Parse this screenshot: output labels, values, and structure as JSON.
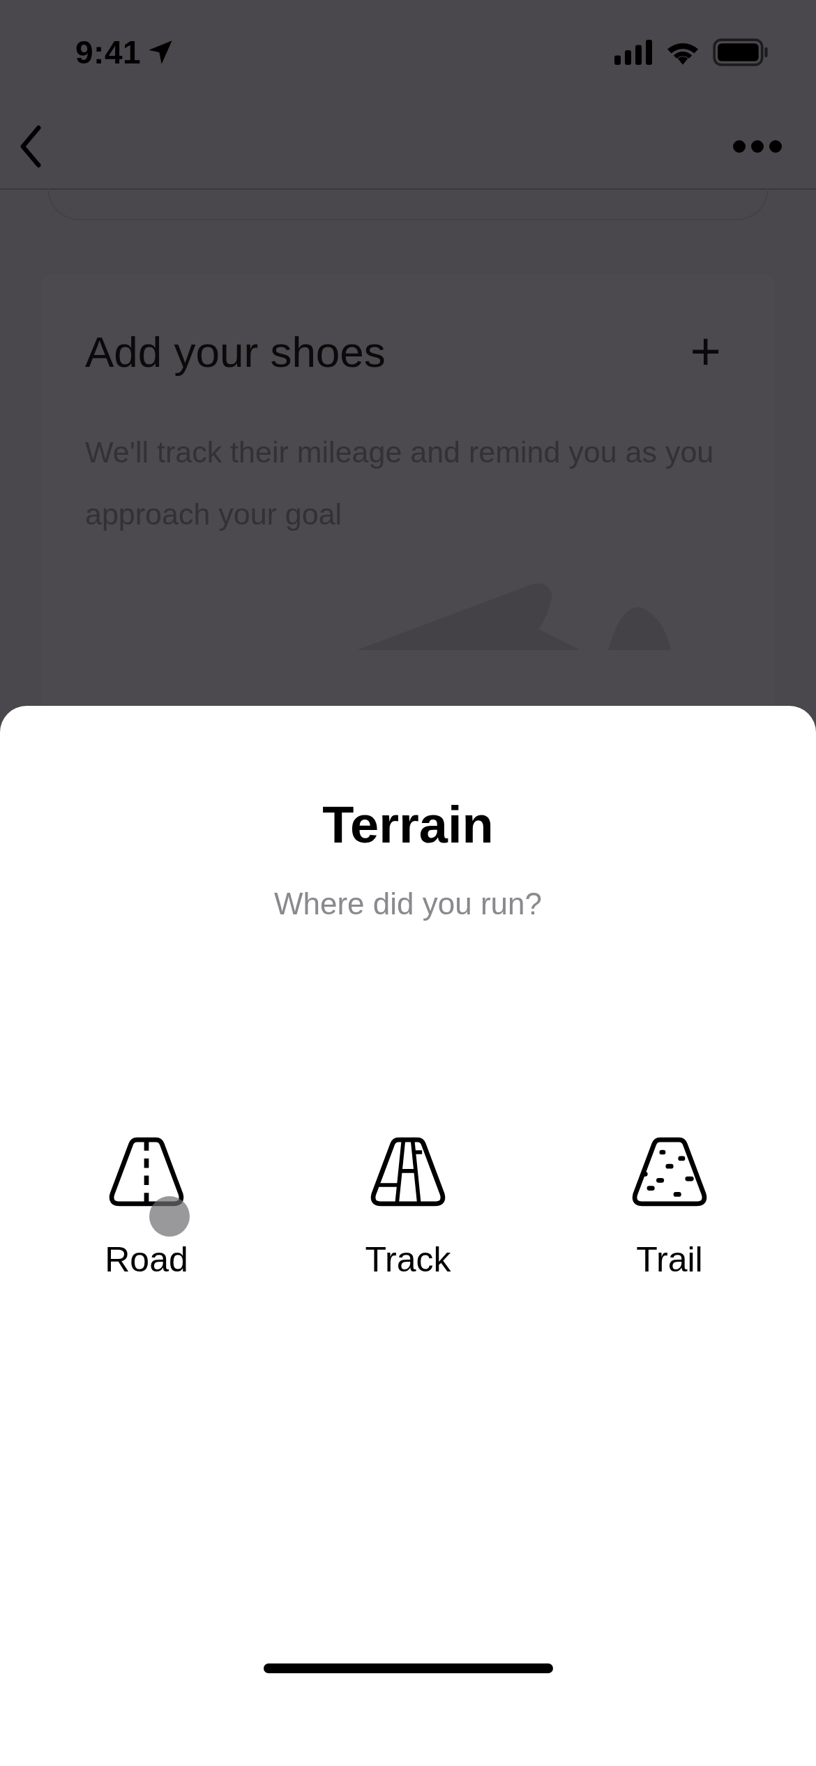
{
  "status_bar": {
    "time": "9:41"
  },
  "card": {
    "title": "Add your shoes",
    "add_icon": "+",
    "description": "We'll track their mileage and remind you as you approach your goal"
  },
  "sheet": {
    "title": "Terrain",
    "subtitle": "Where did you run?",
    "options": [
      {
        "kind": "road",
        "label": "Road",
        "touched": true
      },
      {
        "kind": "track",
        "label": "Track",
        "touched": false
      },
      {
        "kind": "trail",
        "label": "Trail",
        "touched": false
      }
    ]
  }
}
